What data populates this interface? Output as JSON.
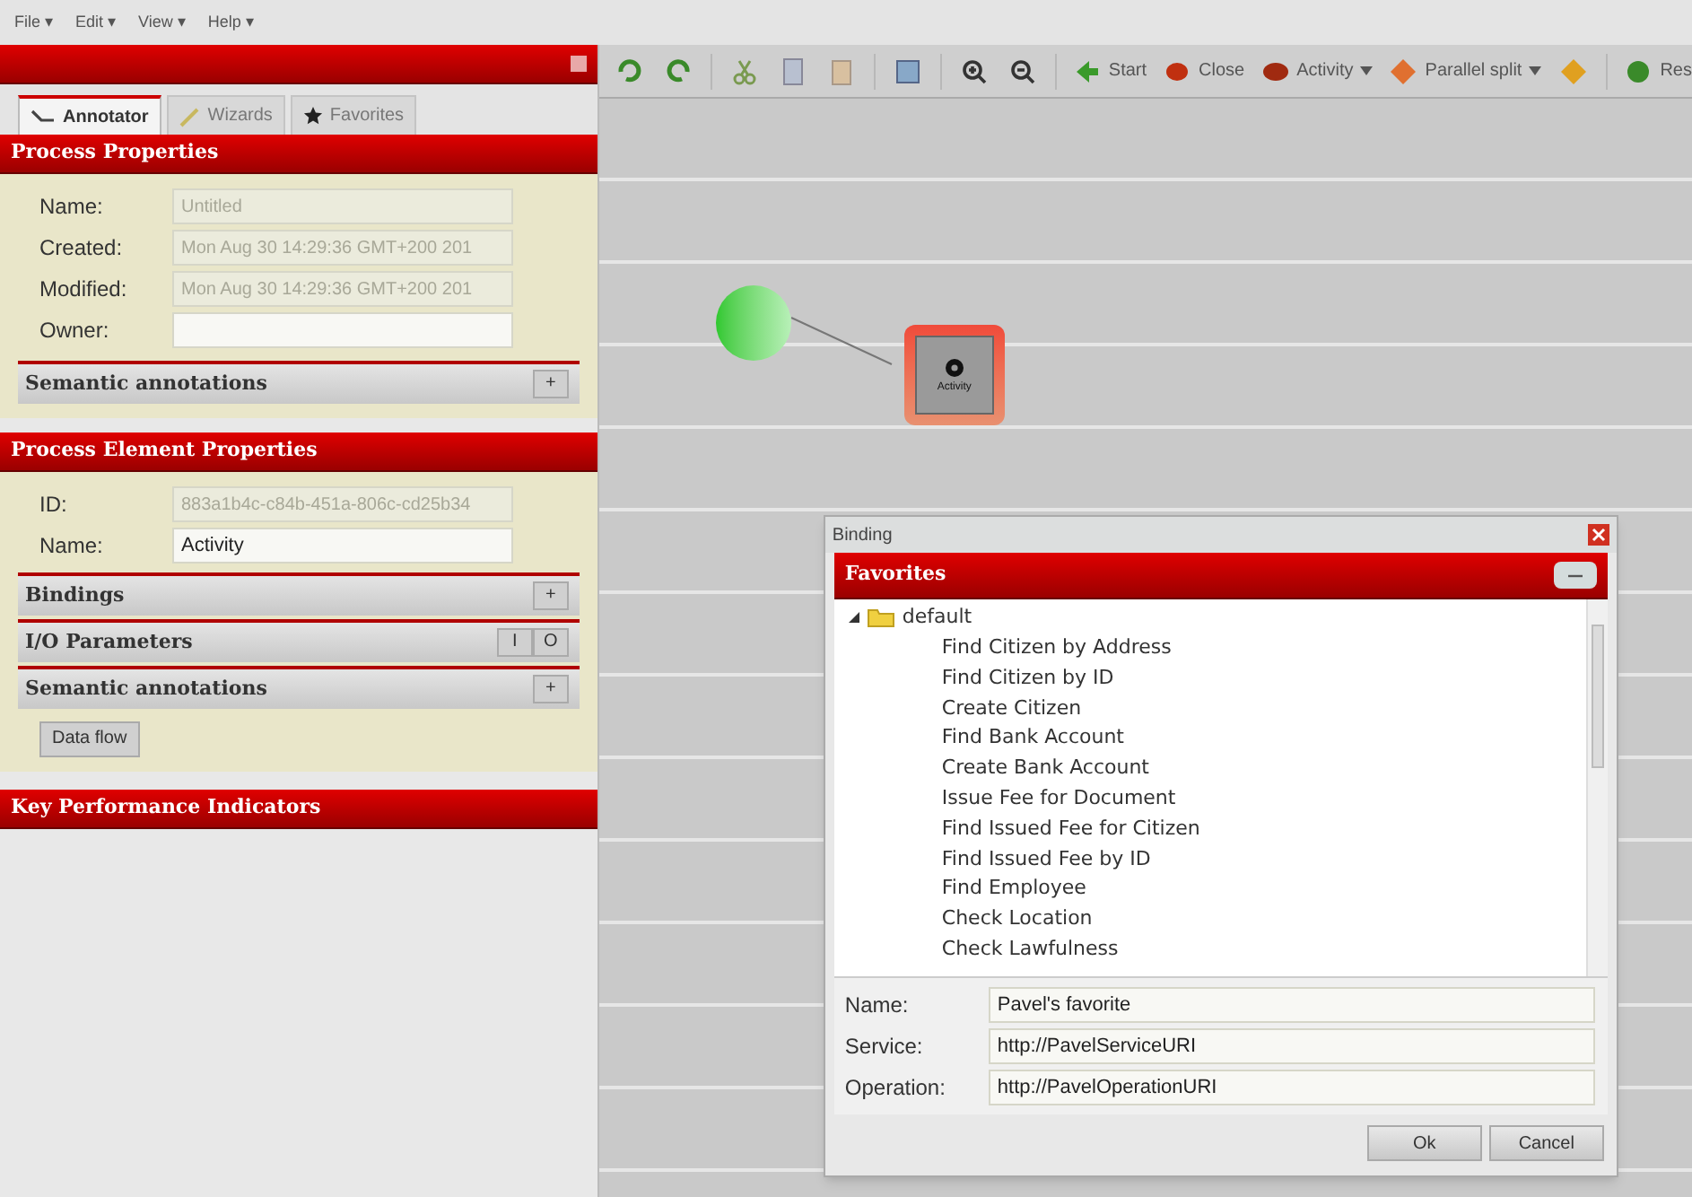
{
  "menu": [
    "File ▾",
    "Edit ▾",
    "View ▾",
    "Help ▾"
  ],
  "tabs": [
    {
      "label": "Annotator",
      "selected": true
    },
    {
      "label": "Wizards",
      "selected": false
    },
    {
      "label": "Favorites",
      "selected": false
    }
  ],
  "process_properties": {
    "title": "Process Properties",
    "fields": [
      {
        "label": "Name:",
        "value": "Untitled",
        "disabled": true
      },
      {
        "label": "Created:",
        "value": "Mon Aug 30 14:29:36 GMT+200 201",
        "disabled": true
      },
      {
        "label": "Modified:",
        "value": "Mon Aug 30 14:29:36 GMT+200 201",
        "disabled": true
      },
      {
        "label": "Owner:",
        "disabled": false
      }
    ],
    "sections": [
      {
        "title": "Semantic annotations",
        "buttons": [
          "+"
        ]
      }
    ]
  },
  "element_properties": {
    "title": "Process Element Properties",
    "fields": [
      {
        "label": "ID:",
        "value": "883a1b4c-c84b-451a-806c-cd25b34",
        "disabled": true
      },
      {
        "label": "Name:",
        "value": "Activity",
        "disabled": false
      }
    ],
    "sections": [
      {
        "title": "Bindings",
        "buttons": [
          "+"
        ]
      },
      {
        "title": "I/O Parameters",
        "buttons": [
          "I",
          "O"
        ]
      },
      {
        "title": "Semantic annotations",
        "buttons": [
          "+"
        ]
      }
    ],
    "button": "Data flow"
  },
  "kpi": {
    "title": "Key Performance Indicators"
  },
  "toolbar": [
    {
      "kind": "undo"
    },
    {
      "kind": "redo"
    },
    {
      "kind": "separator"
    },
    {
      "kind": "cut"
    },
    {
      "kind": "copy"
    },
    {
      "kind": "paste"
    },
    {
      "kind": "separator"
    },
    {
      "kind": "save"
    },
    {
      "kind": "separator"
    },
    {
      "kind": "zoomin"
    },
    {
      "kind": "zoomout"
    },
    {
      "kind": "separator"
    },
    {
      "kind": "start",
      "label": "Start"
    },
    {
      "kind": "close",
      "label": "Close"
    },
    {
      "kind": "activity",
      "label": "Activity",
      "dropdown": true
    },
    {
      "kind": "split",
      "label": "Parallel split",
      "dropdown": true
    },
    {
      "kind": "join"
    },
    {
      "kind": "separator"
    },
    {
      "kind": "res",
      "label": "Res"
    }
  ],
  "canvas": {
    "activity_label": "Activity"
  },
  "dialog": {
    "title": "Binding",
    "panel_title": "Favorites",
    "tree": [
      {
        "label": "default",
        "expanded": true,
        "children": [
          {
            "label": "Find Citizen by Address"
          },
          {
            "label": "Find Citizen by ID"
          },
          {
            "label": "Create Citizen"
          },
          {
            "label": "Find Bank Account"
          },
          {
            "label": "Create Bank Account"
          },
          {
            "label": "Issue Fee for Document"
          },
          {
            "label": "Find Issued Fee for Citizen"
          },
          {
            "label": "Find Issued Fee by ID"
          },
          {
            "label": "Find Employee"
          },
          {
            "label": "Check Location"
          },
          {
            "label": "Check Lawfulness"
          }
        ]
      }
    ],
    "fields": [
      {
        "label": "Name:",
        "value": "Pavel's favorite"
      },
      {
        "label": "Service:",
        "value": "http://PavelServiceURI"
      },
      {
        "label": "Operation:",
        "value": "http://PavelOperationURI"
      }
    ],
    "buttons": [
      "Ok",
      "Cancel"
    ]
  }
}
